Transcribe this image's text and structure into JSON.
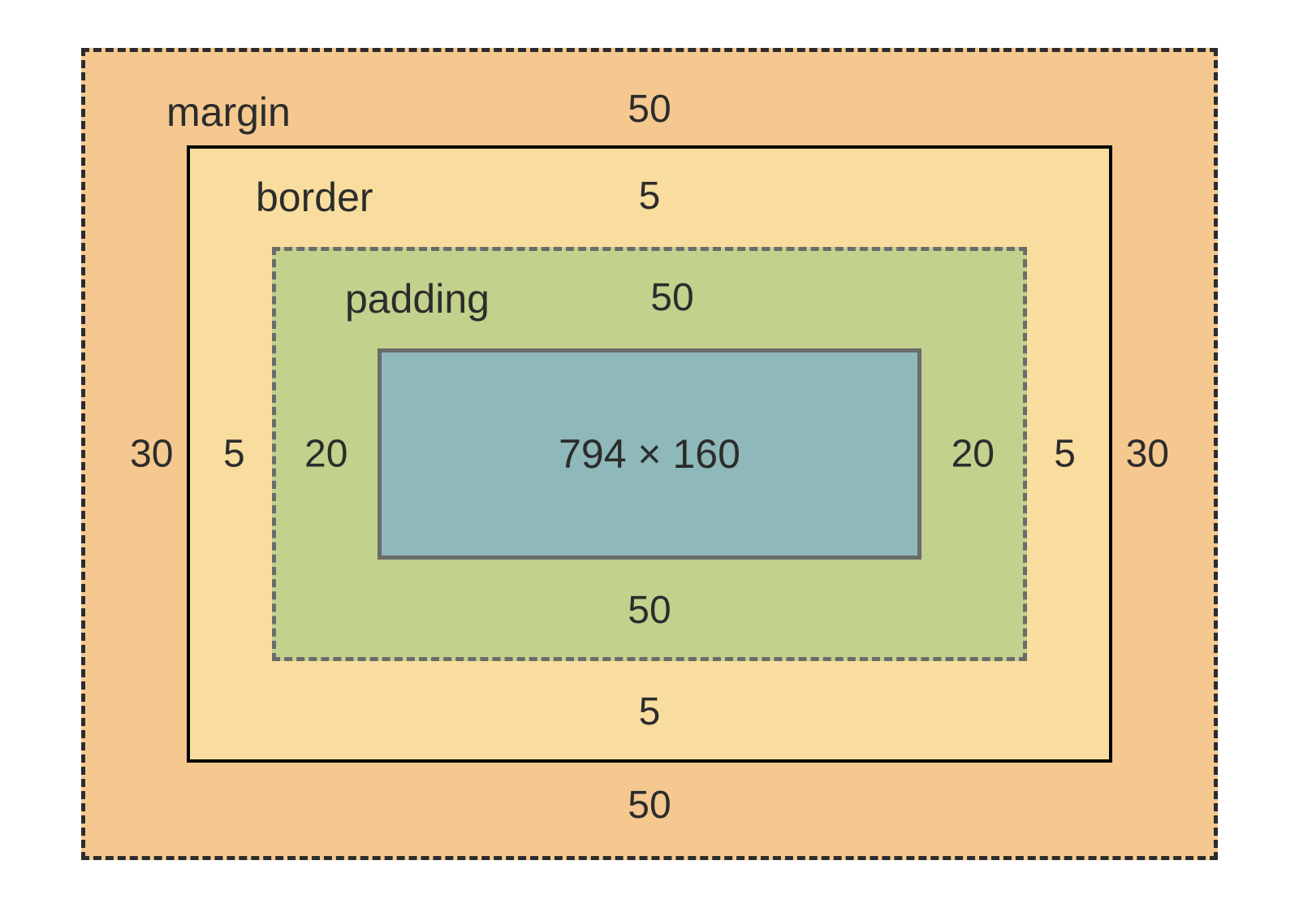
{
  "boxModel": {
    "margin": {
      "label": "margin",
      "top": "50",
      "right": "30",
      "bottom": "50",
      "left": "30"
    },
    "border": {
      "label": "border",
      "top": "5",
      "right": "5",
      "bottom": "5",
      "left": "5"
    },
    "padding": {
      "label": "padding",
      "top": "50",
      "right": "20",
      "bottom": "50",
      "left": "20"
    },
    "content": {
      "dimensions": "794 × 160"
    }
  },
  "colors": {
    "margin": "#f5c88f",
    "border": "#f8dd9e",
    "padding": "#c2d18c",
    "content": "#8eb8b9"
  }
}
